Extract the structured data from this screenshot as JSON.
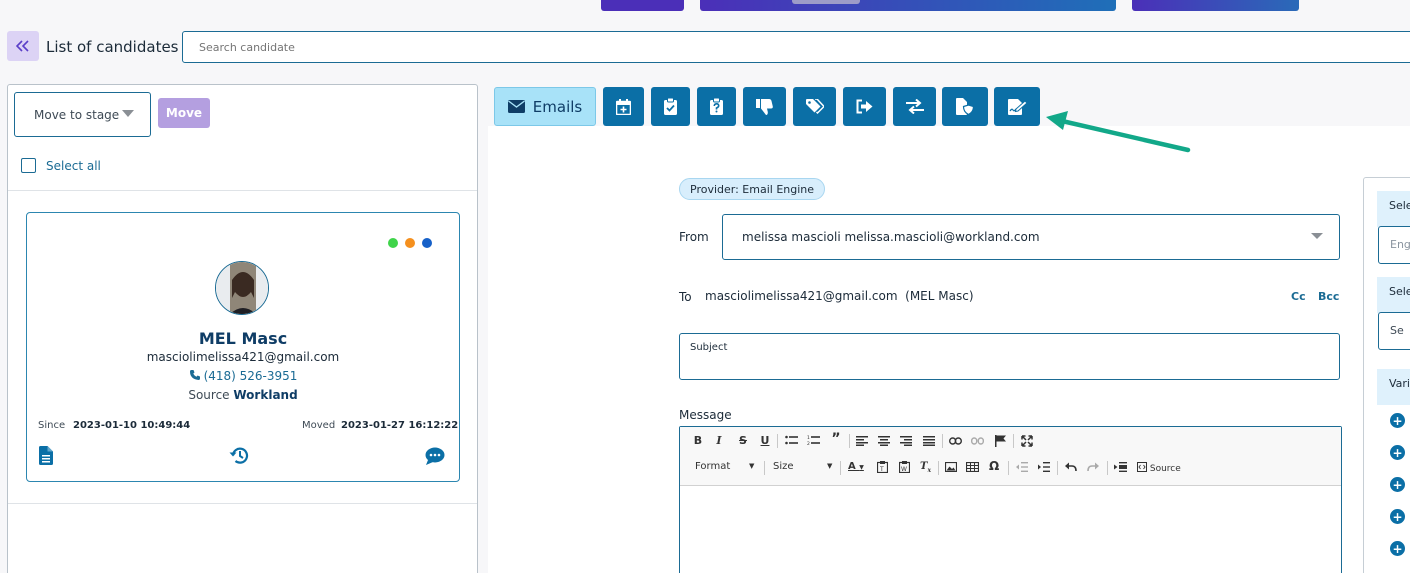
{
  "colors": {
    "primary": "#0b6fa6",
    "accent_purple": "#5a3ec8",
    "light_blue": "#a8e2f8",
    "annotation_arrow": "#12a889",
    "dot_green": "#3fd44a",
    "dot_orange": "#f5901e",
    "dot_blue": "#1660c8"
  },
  "header": {
    "back_icon": "double-chevron-left-icon",
    "title": "List of candidates",
    "search_placeholder": "Search candidate"
  },
  "left_panel": {
    "stage_select": "Move to stage",
    "move_label": "Move",
    "select_all": "Select all"
  },
  "candidate": {
    "name": "MEL Masc",
    "email": "masciolimelissa421@gmail.com",
    "phone": "(418) 526-3951",
    "source_label": "Source",
    "source_value": "Workland",
    "since_label": "Since",
    "since_value": "2023-01-10 10:49:44",
    "moved_label": "Moved",
    "moved_value": "2023-01-27 16:12:22",
    "actions": [
      "document-icon",
      "history-icon",
      "comment-icon"
    ]
  },
  "toolbar": {
    "emails_label": "Emails",
    "tools": [
      "calendar-plus-icon",
      "clipboard-check-icon",
      "clipboard-question-icon",
      "thumbs-down-icon",
      "tags-icon",
      "sign-out-icon",
      "exchange-icon",
      "file-shield-icon",
      "signature-icon"
    ]
  },
  "email_form": {
    "provider": "Provider: Email Engine",
    "from_label": "From",
    "from_value": "melissa mascioli melissa.mascioli@workland.com",
    "to_label": "To",
    "to_value": "masciolimelissa421@gmail.com  (MEL Masc)",
    "cc": "Cc",
    "bcc": "Bcc",
    "subject_label": "Subject",
    "message_label": "Message",
    "editor": {
      "format": "Format",
      "size": "Size",
      "source": "Source"
    }
  },
  "right_panel": {
    "head1": "Sele",
    "input1": "Eng",
    "head2": "Sele",
    "input2": "Se",
    "head3": "Vari"
  }
}
